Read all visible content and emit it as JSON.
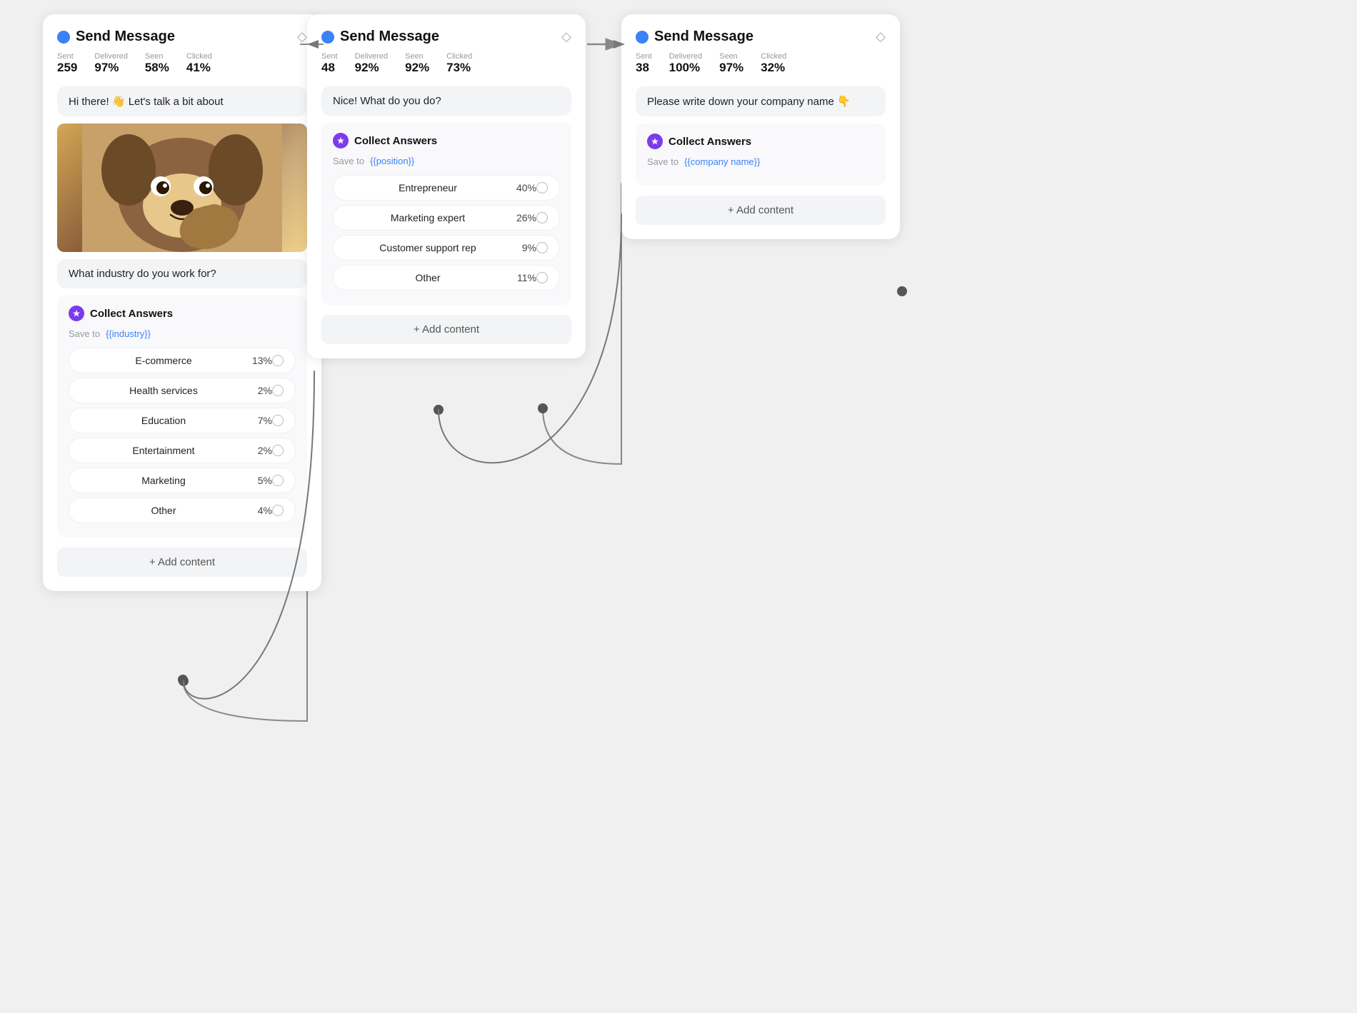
{
  "card1": {
    "title": "Send Message",
    "tag_icon": "🏷",
    "stats": [
      {
        "label": "Sent",
        "value": "259"
      },
      {
        "label": "Delivered",
        "value": "97%"
      },
      {
        "label": "Seen",
        "value": "58%"
      },
      {
        "label": "Clicked",
        "value": "41%"
      }
    ],
    "message1": "Hi there! 👋 Let's talk a bit about",
    "message2": "What industry do you work for?",
    "collect_answers": {
      "title": "Collect Answers",
      "save_to_label": "Save to",
      "save_to_var": "{{industry}}",
      "options": [
        {
          "label": "E-commerce",
          "pct": "13%"
        },
        {
          "label": "Health services",
          "pct": "2%"
        },
        {
          "label": "Education",
          "pct": "7%"
        },
        {
          "label": "Entertainment",
          "pct": "2%"
        },
        {
          "label": "Marketing",
          "pct": "5%"
        },
        {
          "label": "Other",
          "pct": "4%"
        }
      ]
    },
    "add_content": "+ Add content"
  },
  "card2": {
    "title": "Send Message",
    "tag_icon": "🏷",
    "stats": [
      {
        "label": "Sent",
        "value": "48"
      },
      {
        "label": "Delivered",
        "value": "92%"
      },
      {
        "label": "Seen",
        "value": "92%"
      },
      {
        "label": "Clicked",
        "value": "73%"
      }
    ],
    "message1": "Nice! What do you do?",
    "collect_answers": {
      "title": "Collect Answers",
      "save_to_label": "Save to",
      "save_to_var": "{{position}}",
      "options": [
        {
          "label": "Entrepreneur",
          "pct": "40%"
        },
        {
          "label": "Marketing expert",
          "pct": "26%"
        },
        {
          "label": "Customer support rep",
          "pct": "9%"
        },
        {
          "label": "Other",
          "pct": "11%"
        }
      ]
    },
    "add_content": "+ Add content"
  },
  "card3": {
    "title": "Send Message",
    "tag_icon": "🏷",
    "stats": [
      {
        "label": "Sent",
        "value": "38"
      },
      {
        "label": "Delivered",
        "value": "100%"
      },
      {
        "label": "Seen",
        "value": "97%"
      },
      {
        "label": "Clicked",
        "value": "32%"
      }
    ],
    "message1": "Please write down your company name 👇",
    "collect_answers": {
      "title": "Collect Answers",
      "save_to_label": "Save to",
      "save_to_var": "{{company name}}"
    },
    "add_content": "+ Add content"
  },
  "icons": {
    "tag": "◇",
    "collect": "⚡"
  }
}
